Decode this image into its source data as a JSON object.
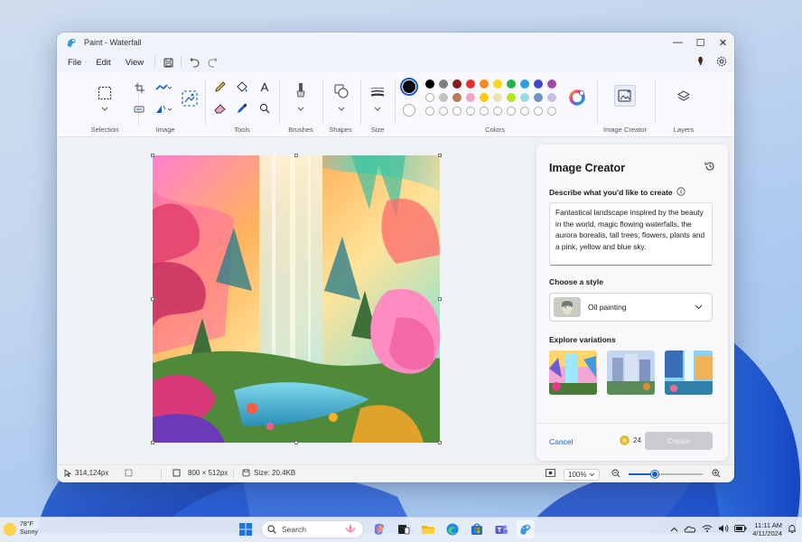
{
  "window": {
    "title": "Paint - Waterfall",
    "controls": {
      "minimize": "—",
      "maximize": "☐",
      "close": "✕"
    }
  },
  "menu": {
    "file": "File",
    "edit": "Edit",
    "view": "View"
  },
  "ribbon": {
    "groups": {
      "selection": "Selection",
      "image": "Image",
      "tools": "Tools",
      "brushes": "Brushes",
      "shapes": "Shapes",
      "size": "Size",
      "colors": "Colors",
      "image_creator": "Image Creator",
      "layers": "Layers"
    },
    "palette_row1": [
      "#000000",
      "#7f7f7f",
      "#8b1a1a",
      "#e23030",
      "#f58a1f",
      "#ffd21f",
      "#22b14c",
      "#2f9be0",
      "#3f48cc",
      "#a349a4"
    ],
    "palette_row2": [
      "#ffffff",
      "#c3c3c3",
      "#b97a57",
      "#f5a3c0",
      "#ffc90e",
      "#efe4b0",
      "#b5e61d",
      "#99d9ea",
      "#7092be",
      "#c8bfe7"
    ],
    "primary_color": "#000000",
    "secondary_color": "#ffffff"
  },
  "panel": {
    "title": "Image Creator",
    "describe_label": "Describe what you'd like to create",
    "prompt": "Fantastical landscape inspired by the beauty in the world, magic flowing waterfalls, the aurora borealis, tall trees, flowers, plants and a pink, yellow and blue sky.",
    "style_label": "Choose a style",
    "style_value": "Oil painting",
    "variations_label": "Explore variations",
    "cancel": "Cancel",
    "credits": "24",
    "create": "Create"
  },
  "status": {
    "cursor": "314,124px",
    "canvas_size": "800 × 512px",
    "file_size": "Size: 20.4KB",
    "zoom": "100%",
    "zoom_level": 0.35
  },
  "taskbar": {
    "temp": "78°F",
    "weather": "Sunny",
    "search_placeholder": "Search",
    "time": "11:11 AM",
    "date": "4/11/2024"
  }
}
